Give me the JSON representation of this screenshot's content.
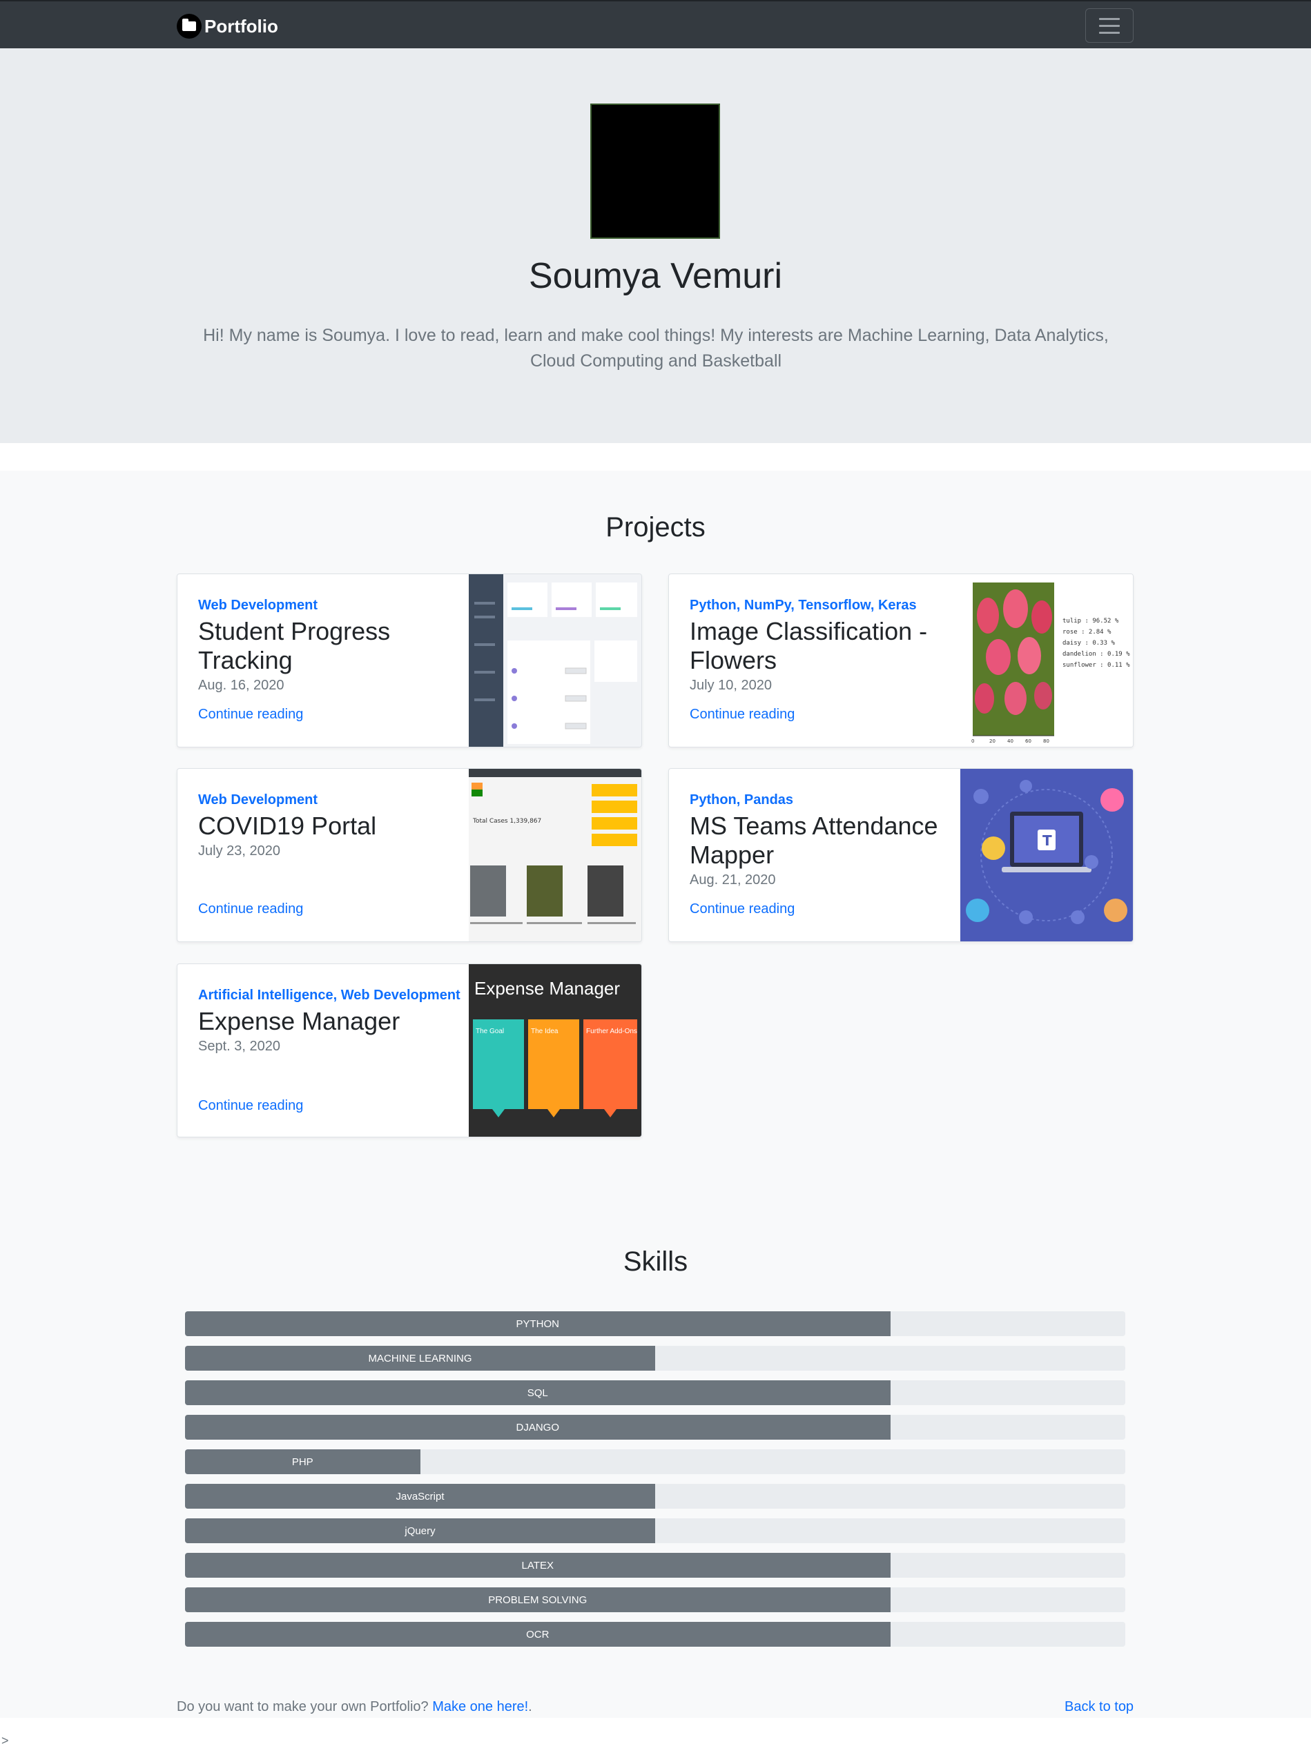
{
  "navbar": {
    "brand": "Portfolio"
  },
  "hero": {
    "name": "Soumya Vemuri",
    "bio": "Hi! My name is Soumya. I love to read, learn and make cool things! My interests are Machine Learning, Data Analytics, Cloud Computing and Basketball"
  },
  "projects": {
    "title": "Projects",
    "items": [
      {
        "category": "Web Development",
        "title": "Student Progress Tracking",
        "date": "Aug. 16, 2020",
        "link": "Continue reading"
      },
      {
        "category": "Python, NumPy, Tensorflow, Keras",
        "title": "Image Classification - Flowers",
        "date": "July 10, 2020",
        "link": "Continue reading"
      },
      {
        "category": "Web Development",
        "title": "COVID19 Portal",
        "date": "July 23, 2020",
        "link": "Continue reading"
      },
      {
        "category": "Python, Pandas",
        "title": "MS Teams Attendance Mapper",
        "date": "Aug. 21, 2020",
        "link": "Continue reading"
      },
      {
        "category": "Artificial Intelligence, Web Development",
        "title": "Expense Manager",
        "date": "Sept. 3, 2020",
        "link": "Continue reading"
      }
    ]
  },
  "thumbs": {
    "flowers_text": [
      "tulip : 96.52 %",
      "rose : 2.84 %",
      "daisy : 0.33 %",
      "dandelion : 0.19 %",
      "sunflower : 0.11 %"
    ],
    "flowers_axis": [
      "0",
      "20",
      "40",
      "60",
      "80"
    ],
    "covid_total": "Total Cases 1,339,867",
    "expense_title": "Expense Manager",
    "expense_boxes": [
      "The Goal",
      "The Idea",
      "Further Add-Ons"
    ]
  },
  "skills": {
    "title": "Skills",
    "items": [
      {
        "name": "PYTHON",
        "level": 0.75
      },
      {
        "name": "MACHINE LEARNING",
        "level": 0.5
      },
      {
        "name": "SQL",
        "level": 0.75
      },
      {
        "name": "DJANGO",
        "level": 0.75
      },
      {
        "name": "PHP",
        "level": 0.25
      },
      {
        "name": "JavaScript",
        "level": 0.5
      },
      {
        "name": "jQuery",
        "level": 0.5
      },
      {
        "name": "LATEX",
        "level": 0.75
      },
      {
        "name": "PROBLEM SOLVING",
        "level": 0.75
      },
      {
        "name": "OCR",
        "level": 0.75
      }
    ]
  },
  "footer": {
    "text": "Do you want to make your own Portfolio? ",
    "link": "Make one here!",
    "after": ".",
    "back_to_top": "Back to top"
  },
  "stray_char": ">"
}
